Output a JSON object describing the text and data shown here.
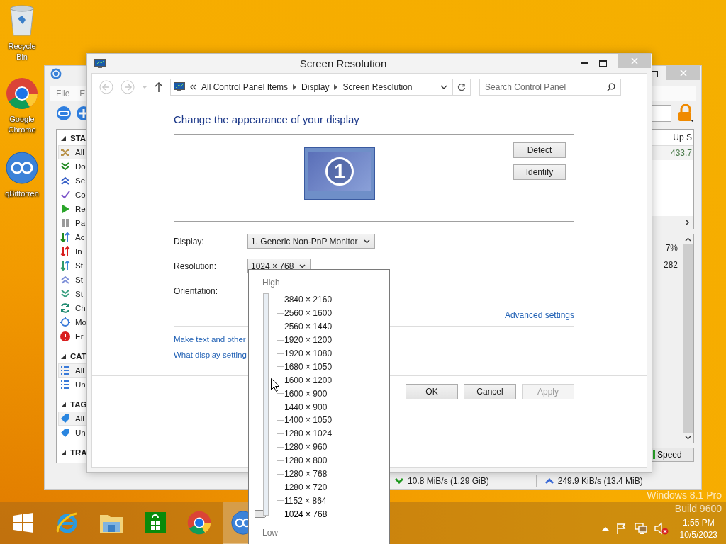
{
  "desktop_icons": [
    {
      "kind": "recycle-bin",
      "label": "Recycle Bin"
    },
    {
      "kind": "chrome",
      "label": "Google Chrome"
    },
    {
      "kind": "qbittorrent",
      "label": "qBittorren"
    }
  ],
  "qbittorrent": {
    "menu": [
      "File",
      "E"
    ],
    "sections": [
      {
        "title": "STA",
        "items": [
          {
            "kind": "shuffle",
            "label": "All",
            "selected": true
          },
          {
            "kind": "down",
            "label": "Do",
            "selected": false
          },
          {
            "kind": "up",
            "label": "Se",
            "selected": false
          },
          {
            "kind": "check",
            "label": "Co",
            "selected": false
          },
          {
            "kind": "play",
            "label": "Re",
            "selected": false
          },
          {
            "kind": "pause",
            "label": "Pa",
            "selected": false
          },
          {
            "kind": "active",
            "label": "Ac",
            "selected": false
          },
          {
            "kind": "inactive",
            "label": "In",
            "selected": false
          },
          {
            "kind": "stalled",
            "label": "St",
            "selected": false
          },
          {
            "kind": "stalled-up",
            "label": "St",
            "selected": false
          },
          {
            "kind": "stalled-down",
            "label": "St",
            "selected": false
          },
          {
            "kind": "checking",
            "label": "Ch",
            "selected": false
          },
          {
            "kind": "moving",
            "label": "Mo",
            "selected": false
          },
          {
            "kind": "error",
            "label": "Er",
            "selected": false
          }
        ]
      },
      {
        "title": "CAT",
        "items": [
          {
            "kind": "list",
            "label": "All",
            "selected": true
          },
          {
            "kind": "list",
            "label": "Un",
            "selected": false
          }
        ]
      },
      {
        "title": "TAG",
        "items": [
          {
            "kind": "tag",
            "label": "All",
            "selected": true
          },
          {
            "kind": "tag",
            "label": "Un",
            "selected": false
          }
        ]
      },
      {
        "title": "TRA"
      }
    ],
    "table": {
      "column_1": "Up S",
      "row_1": "433.7"
    },
    "properties": {
      "field_1": "7%",
      "field_2": "282"
    },
    "speed_tab": "Speed",
    "status_bar": {
      "download": "10.8 MiB/s (1.29 GiB)",
      "upload": "249.9 KiB/s (13.4 MiB)"
    }
  },
  "screen_resolution": {
    "title": "Screen Resolution",
    "breadcrumb": [
      "All Control Panel Items",
      "Display",
      "Screen Resolution"
    ],
    "search": {
      "placeholder": "Search Control Panel"
    },
    "heading": "Change the appearance of your display",
    "monitor_number": "1",
    "side_buttons": [
      "Detect",
      "Identify"
    ],
    "display": {
      "label": "Display:",
      "value": "1. Generic Non-PnP Monitor"
    },
    "resolution": {
      "label": "Resolution:",
      "value": "1024 × 768"
    },
    "orientation": {
      "label": "Orientation:"
    },
    "advanced_link": "Advanced settings",
    "links": [
      "Make text and other",
      "What display setting"
    ],
    "buttons": [
      {
        "label": "OK",
        "disabled": false
      },
      {
        "label": "Cancel",
        "disabled": false
      },
      {
        "label": "Apply",
        "disabled": true
      }
    ]
  },
  "resolution_list": {
    "high": "High",
    "low": "Low",
    "items": [
      {
        "label": "3840 × 2160",
        "selected": false
      },
      {
        "label": "2560 × 1600",
        "selected": false
      },
      {
        "label": "2560 × 1440",
        "selected": false
      },
      {
        "label": "1920 × 1200",
        "selected": false
      },
      {
        "label": "1920 × 1080",
        "selected": false
      },
      {
        "label": "1680 × 1050",
        "selected": false
      },
      {
        "label": "1600 × 1200",
        "selected": false
      },
      {
        "label": "1600 × 900",
        "selected": false
      },
      {
        "label": "1440 × 900",
        "selected": false
      },
      {
        "label": "1400 × 1050",
        "selected": false
      },
      {
        "label": "1280 × 1024",
        "selected": false
      },
      {
        "label": "1280 × 960",
        "selected": false
      },
      {
        "label": "1280 × 800",
        "selected": false
      },
      {
        "label": "1280 × 768",
        "selected": false
      },
      {
        "label": "1280 × 720",
        "selected": false
      },
      {
        "label": "1152 × 864",
        "selected": false
      },
      {
        "label": "1024 × 768",
        "selected": true
      }
    ]
  },
  "os_watermark": {
    "edition": "Windows 8.1 Pro",
    "build": "Build 9600"
  },
  "taskbar": {
    "apps": [
      {
        "kind": "start",
        "active": false
      },
      {
        "kind": "internet-explorer",
        "active": false
      },
      {
        "kind": "file-explorer",
        "active": false
      },
      {
        "kind": "store",
        "active": false
      },
      {
        "kind": "chrome",
        "active": false
      },
      {
        "kind": "qbittorrent",
        "active": true
      }
    ],
    "clock": {
      "time": "1:55 PM",
      "date": "10/5/2023"
    }
  }
}
